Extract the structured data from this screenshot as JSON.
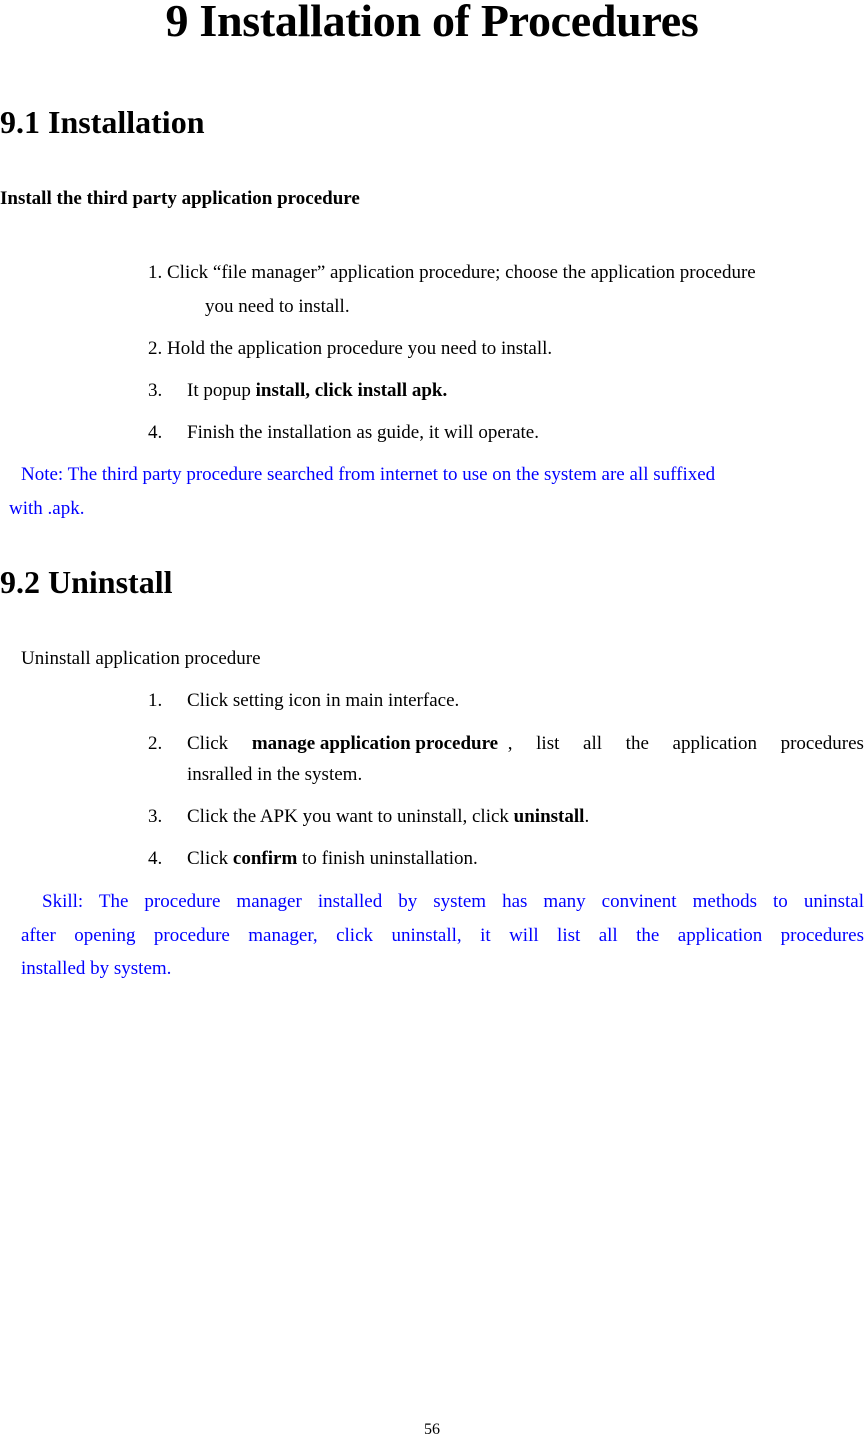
{
  "page": {
    "title": "9 Installation of Procedures",
    "page_number": "56"
  },
  "section_install": {
    "heading": "9.1 Installation",
    "subheading": "Install the third party application procedure",
    "steps": [
      {
        "num": "1.",
        "text_a": "Click “file manager” application procedure; choose the application procedure",
        "text_b": "you need to install."
      },
      {
        "num": "2.",
        "text": "Hold the application procedure you need to install."
      },
      {
        "num": "3.",
        "text": "It popup ",
        "bold": "install, click install apk."
      },
      {
        "num": "4.",
        "text": "Finish the installation as guide, it will operate."
      }
    ],
    "note_line1": "Note: The third party procedure searched from internet to use on the system are all suffixed",
    "note_line2": "with .apk."
  },
  "section_uninstall": {
    "heading": "9.2 Uninstall",
    "intro": "Uninstall application procedure",
    "steps": [
      {
        "num": "1.",
        "text": "Click setting icon in main interface."
      },
      {
        "num": "2.",
        "pre": "Click",
        "bold": "manage application procedure",
        "post_words": [
          ",",
          "list",
          "all",
          "the",
          "application",
          "procedures"
        ],
        "line2": "insralled in the system."
      },
      {
        "num": "3.",
        "text": "Click the APK you want to uninstall, click ",
        "bold": "uninstall",
        "after": "."
      },
      {
        "num": "4.",
        "pre": "Click ",
        "bold": "confirm",
        "after": " to finish uninstallation."
      }
    ],
    "skill_line1": "Skill: The procedure manager installed by system has many convinent methods to uninstal",
    "skill_line2": "after opening procedure manager, click uninstall, it will list all the application procedures",
    "skill_line3": "installed by system."
  }
}
